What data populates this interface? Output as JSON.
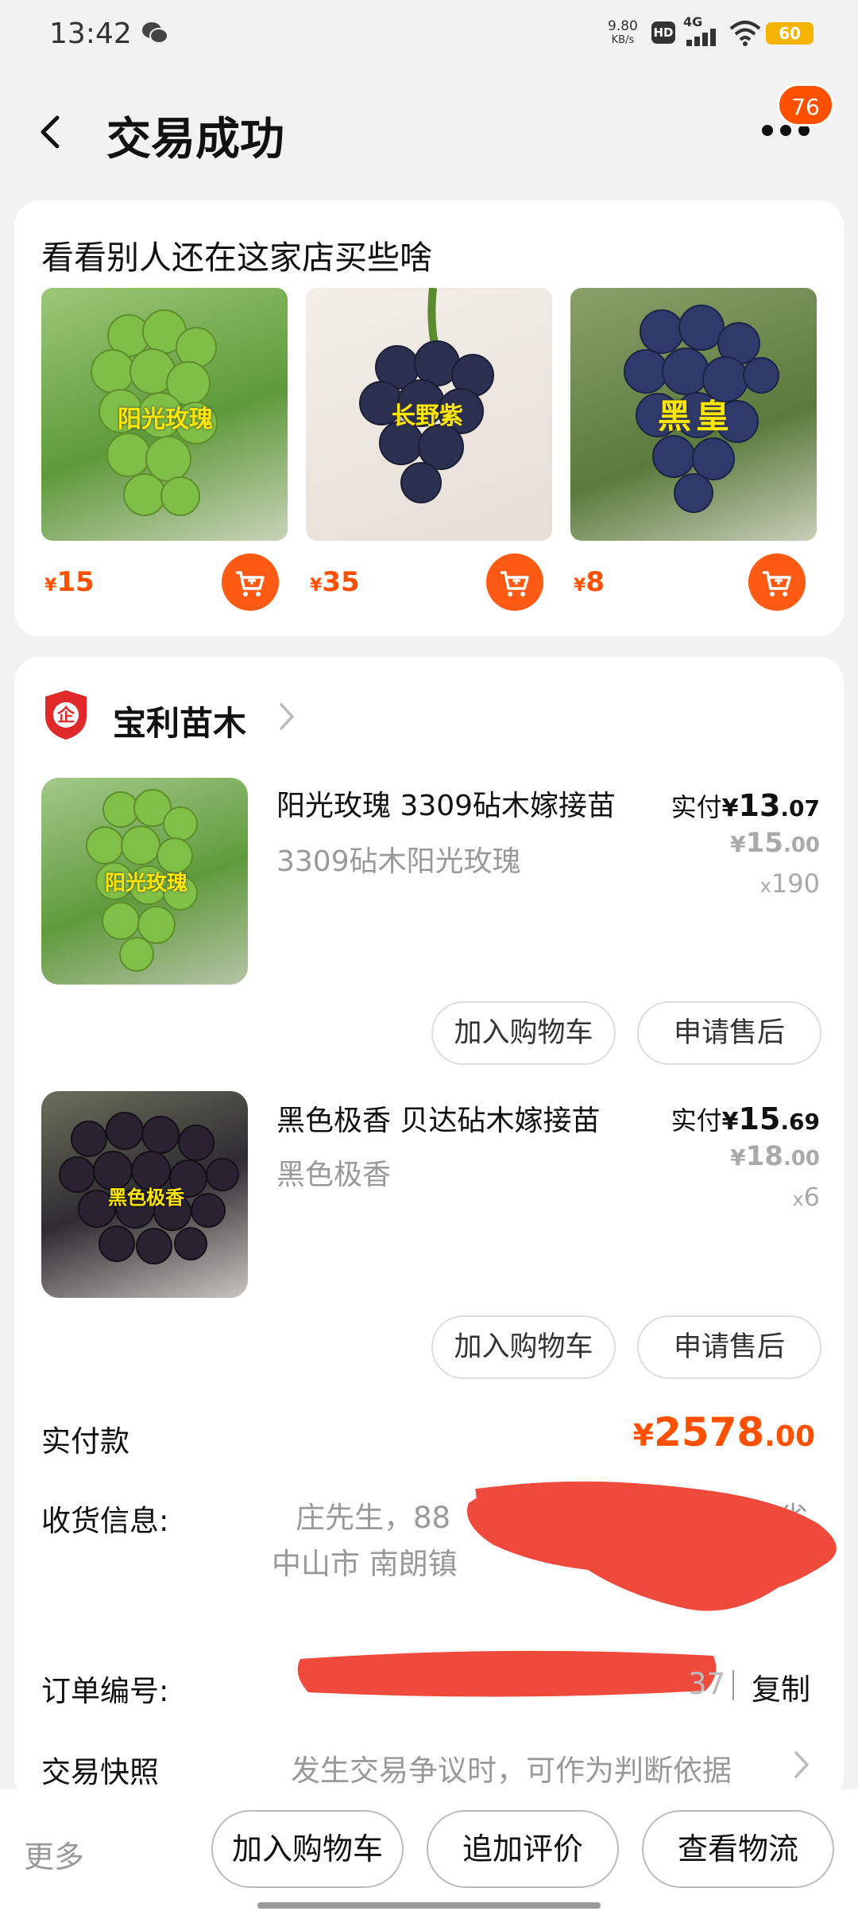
{
  "status_bar": {
    "time": "13:42",
    "speed_value": "9.80",
    "speed_unit": "KB/s",
    "hd": "HD",
    "network": "4G",
    "battery": "60"
  },
  "header": {
    "title": "交易成功",
    "badge_count": "76"
  },
  "recommend": {
    "title": "看看别人还在这家店买些啥",
    "items": [
      {
        "label": "阳光玫瑰",
        "price_symbol": "¥",
        "price": "15",
        "color": "#6fae3c"
      },
      {
        "label": "长野紫",
        "price_symbol": "¥",
        "price": "35",
        "color": "#2e3148"
      },
      {
        "label": "黑皇",
        "price_symbol": "¥",
        "price": "8",
        "color": "#2c3564"
      }
    ]
  },
  "shop": {
    "name": "宝利苗木"
  },
  "order_items": [
    {
      "title": "阳光玫瑰  3309砧木嫁接苗",
      "spec": "3309砧木阳光玫瑰",
      "pay_label": "实付",
      "pay_symbol": "¥",
      "pay_int": "13",
      "pay_dec": ".07",
      "orig_symbol": "¥",
      "orig_int": "15",
      "orig_dec": ".00",
      "qty_prefix": "x",
      "qty": "190",
      "img_label": "阳光玫瑰",
      "btn_cart": "加入购物车",
      "btn_after": "申请售后"
    },
    {
      "title": "黑色极香  贝达砧木嫁接苗",
      "spec": "黑色极香",
      "pay_label": "实付",
      "pay_symbol": "¥",
      "pay_int": "15",
      "pay_dec": ".69",
      "orig_symbol": "¥",
      "orig_int": "18",
      "orig_dec": ".00",
      "qty_prefix": "x",
      "qty": "6",
      "img_label": "黑色极香",
      "btn_cart": "加入购物车",
      "btn_after": "申请售后"
    }
  ],
  "summary": {
    "paid_label": "实付款",
    "paid_symbol": "¥",
    "paid_int": "2578",
    "paid_dec": ".00",
    "address_label": "收货信息:",
    "address_line1_name": "庄先生，88",
    "address_line1_province": "广东省",
    "address_line2": "中山市  南朗镇",
    "order_no_label": "订单编号:",
    "order_no_tail": "37",
    "copy_label": "复制",
    "snapshot_label": "交易快照",
    "snapshot_hint": "发生交易争议时，可作为判断依据"
  },
  "bottom_bar": {
    "more": "更多",
    "add_cart": "加入购物车",
    "review": "追加评价",
    "logistics": "查看物流"
  },
  "colors": {
    "accent": "#ff5000",
    "redaction": "#f04a3c"
  }
}
